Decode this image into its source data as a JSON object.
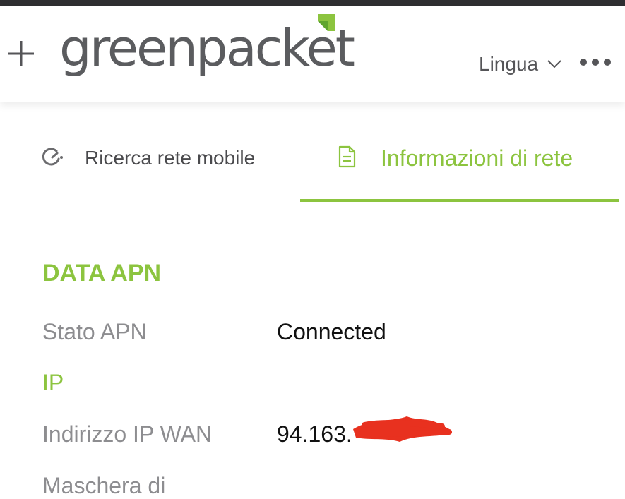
{
  "header": {
    "plus_icon": "plus-icon",
    "logo_text": "greenpacket",
    "language_label": "Lingua",
    "language_icon": "chevron-down-icon",
    "more_icon": "more-horizontal-icon"
  },
  "tabs": [
    {
      "label": "Ricerca rete mobile",
      "icon": "network-search-icon",
      "active": false
    },
    {
      "label": "Informazioni di rete",
      "icon": "document-icon",
      "active": true
    }
  ],
  "section": {
    "title": "DATA APN",
    "apn_status_label": "Stato APN",
    "apn_status_value": "Connected",
    "ip_heading": "IP",
    "wan_ip_label": "Indirizzo IP WAN",
    "wan_ip_value": "94.163.",
    "subnet_label": "Maschera di"
  },
  "colors": {
    "accent": "#8cc43f",
    "label_gray": "#8d8d90",
    "redaction": "#e8311f",
    "top_bar": "#2e2e31"
  }
}
